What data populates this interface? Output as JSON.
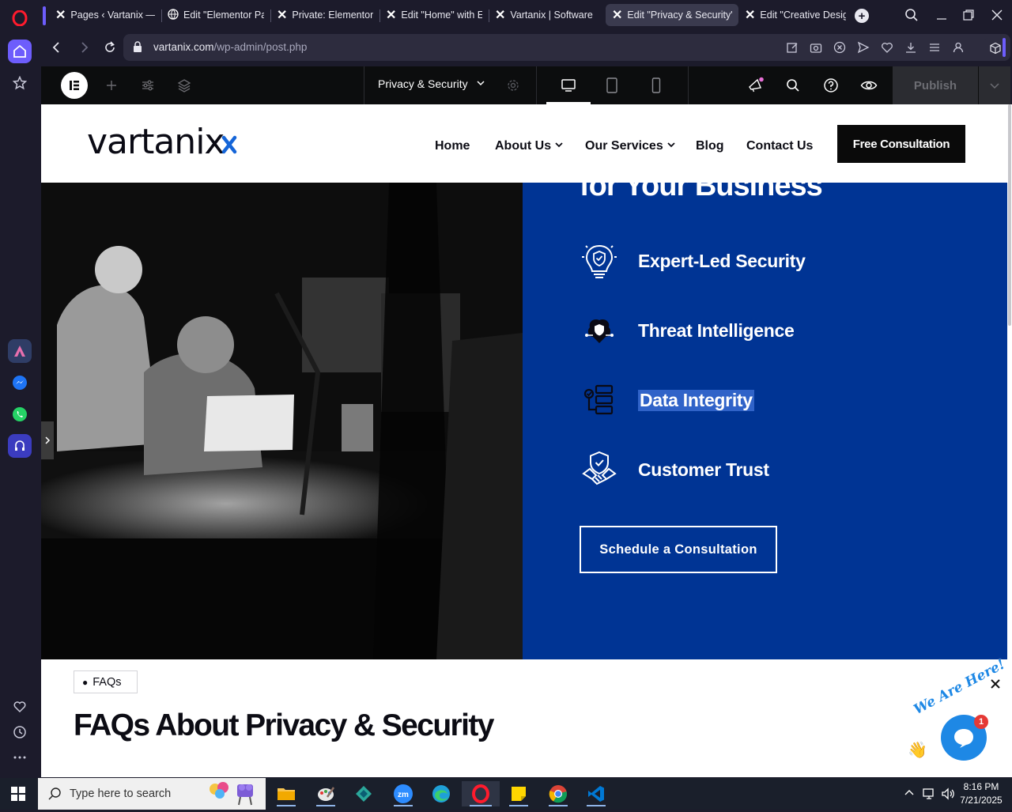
{
  "browser": {
    "tabs": [
      {
        "title": "Pages ‹ Vartanix — W"
      },
      {
        "title": "Edit \"Elementor Page"
      },
      {
        "title": "Private: Elementor P"
      },
      {
        "title": "Edit \"Home\" with Ele"
      },
      {
        "title": "Vartanix | Software D"
      },
      {
        "title": "Edit \"Privacy & Security\" w"
      },
      {
        "title": "Edit \"Creative Design"
      }
    ],
    "url_domain": "vartanix.com",
    "url_path": "/wp-admin/post.php"
  },
  "elementor": {
    "page_name": "Privacy & Security",
    "publish_label": "Publish"
  },
  "site": {
    "logo_text": "vartanix",
    "nav": [
      {
        "label": "Home"
      },
      {
        "label": "About Us"
      },
      {
        "label": "Our Services"
      },
      {
        "label": "Blog"
      },
      {
        "label": "Contact Us"
      }
    ],
    "cta_label": "Free Consultation",
    "hero_heading_partial": "for Your Business",
    "features": [
      {
        "label": "Expert-Led Security",
        "icon": "lightbulb-shield-icon"
      },
      {
        "label": "Threat Intelligence",
        "icon": "brain-shield-icon"
      },
      {
        "label": "Data Integrity",
        "icon": "database-check-icon"
      },
      {
        "label": "Customer Trust",
        "icon": "handshake-shield-icon"
      }
    ],
    "schedule_label": "Schedule a Consultation",
    "faq_badge": "FAQs",
    "faq_heading": "FAQs About Privacy & Security",
    "chat_badge_text": "We Are Here!",
    "chat_count": "1"
  },
  "taskbar": {
    "search_placeholder": "Type here to search",
    "time": "8:16 PM",
    "date": "7/21/2025"
  },
  "colors": {
    "brand_blue": "#003494",
    "chat_blue": "#1e88e5",
    "opera_red": "#ff1b2d",
    "sidebar_accent": "#6d5dfc"
  }
}
